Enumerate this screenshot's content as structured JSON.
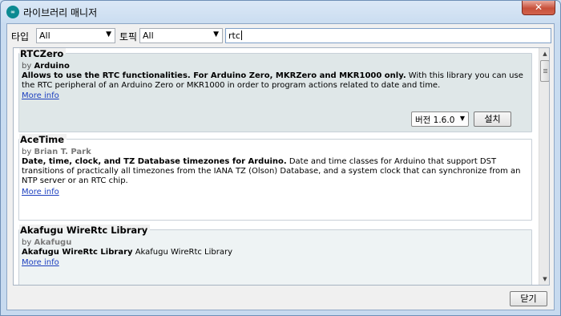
{
  "window": {
    "title": "라이브러리 매니저",
    "app_icon": "arduino-logo",
    "close_glyph": "✕"
  },
  "filters": {
    "type_label": "타입",
    "type_value": "All",
    "topic_label": "토픽",
    "topic_value": "All",
    "search_value": "rtc"
  },
  "libraries": [
    {
      "name": "RTCZero",
      "by_prefix": "by",
      "author": "Arduino",
      "sentence": "Allows to use the RTC functionalities. For Arduino Zero, MKRZero and MKR1000 only.",
      "paragraph": " With this library you can use the RTC peripheral of an Arduino Zero or MKR1000 in order to program actions related to date and time.",
      "more_info": "More info",
      "version_label": "버전 1.6.0",
      "install_label": "설치"
    },
    {
      "name": "AceTime",
      "by_prefix": "by",
      "author": "Brian T. Park",
      "sentence": "Date, time, clock, and TZ Database timezones for Arduino.",
      "paragraph": " Date and time classes for Arduino that support DST transitions of practically all timezones from the IANA TZ (Olson) Database, and a system clock that can synchronize from an NTP server or an RTC chip.",
      "more_info": "More info"
    },
    {
      "name": "Akafugu WireRtc Library",
      "by_prefix": "by",
      "author": "Akafugu",
      "sentence": "Akafugu WireRtc Library",
      "paragraph": " Akafugu WireRtc Library",
      "more_info": "More info"
    }
  ],
  "footer": {
    "close_label": "닫기"
  }
}
